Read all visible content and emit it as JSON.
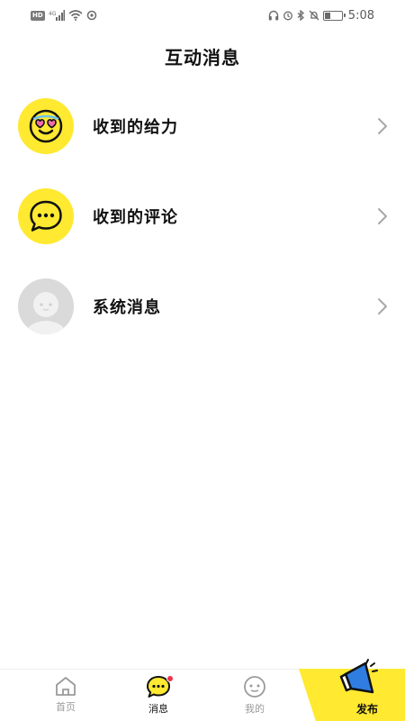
{
  "status_bar": {
    "left_icons": [
      "hd-icon",
      "signal-icon",
      "wifi-icon",
      "sync-icon"
    ],
    "right_icons": [
      "headphones-icon",
      "alarm-icon",
      "bluetooth-icon",
      "mute-icon",
      "battery-icon"
    ],
    "battery_level": 0.35,
    "time": "5:08"
  },
  "header": {
    "title": "互动消息"
  },
  "messages": [
    {
      "label": "收到的给力",
      "avatar_icon": "heart-eyes-face-icon",
      "avatar_color": "#ffe931"
    },
    {
      "label": "收到的评论",
      "avatar_icon": "comment-bubble-icon",
      "avatar_color": "#ffe931"
    },
    {
      "label": "系统消息",
      "avatar_icon": "default-avatar-icon",
      "avatar_color": "#d9d9d9"
    }
  ],
  "tab_bar": {
    "tabs": [
      {
        "label": "首页",
        "icon": "home-icon",
        "active": false
      },
      {
        "label": "消息",
        "icon": "message-icon",
        "active": true,
        "has_badge": true
      },
      {
        "label": "我的",
        "icon": "profile-icon",
        "active": false
      }
    ],
    "publish": {
      "label": "发布",
      "icon": "megaphone-icon",
      "color": "#ffe931"
    }
  },
  "colors": {
    "accent": "#ffe931",
    "badge": "#f0324b",
    "text": "#111111",
    "muted": "#9a9a9a"
  }
}
